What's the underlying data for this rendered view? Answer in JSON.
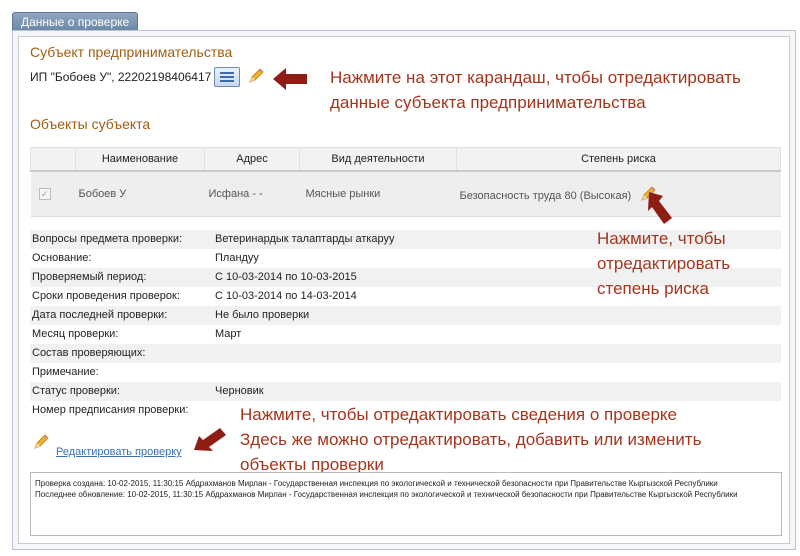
{
  "tab_title": "Данные о проверке",
  "subject": {
    "section_title": "Субъект предпринимательства",
    "text": "ИП \"Бобоев У\", 22202198406417"
  },
  "objects": {
    "section_title": "Объекты субъекта",
    "columns": [
      "Наименование",
      "Адрес",
      "Вид деятельности",
      "Степень риска"
    ],
    "rows": [
      {
        "checked": true,
        "name": "Бобоев У",
        "address": "Исфана - -",
        "activity": "Мясные рынки",
        "risk": "Безопасность труда 80 (Высокая)"
      }
    ]
  },
  "details": [
    {
      "label": "Вопросы предмета проверки:",
      "value": "Ветеринардык талаптарды аткаруу"
    },
    {
      "label": "Основание:",
      "value": "Пландуу"
    },
    {
      "label": "Проверяемый период:",
      "value": "С 10-03-2014 по 10-03-2015"
    },
    {
      "label": "Сроки проведения проверок:",
      "value": "С 10-03-2014 по 14-03-2014"
    },
    {
      "label": "Дата последней проверки:",
      "value": "Не было проверки"
    },
    {
      "label": "Месяц проверки:",
      "value": "Март"
    },
    {
      "label": "Состав проверяющих:",
      "value": ""
    },
    {
      "label": "Примечание:",
      "value": ""
    },
    {
      "label": "Статус проверки:",
      "value": "Черновик"
    },
    {
      "label": "Номер предписания проверки:",
      "value": ""
    }
  ],
  "edit_link": "Редактировать проверку",
  "log": {
    "created": "Проверка создана: 10-02-2015, 11:30:15 Абдрахманов Мирлан - Государственная инспекция по экологической и технической безопасности при Правительстве Кыргызской Республики",
    "updated": "Последнее обновление: 10-02-2015, 11:30:15 Абдрахманов Мирлан - Государственная инспекция по экологической и технической безопасности при Правительстве Кыргызской Республики"
  },
  "annotations": {
    "subject": [
      "Нажмите на этот карандаш, чтобы отредактировать",
      "данные субъекта предпринимательства"
    ],
    "risk": [
      "Нажмите, чтобы",
      "отредактировать",
      "степень риска"
    ],
    "inspection": [
      "Нажмите, чтобы отредактировать сведения о проверке",
      "Здесь же можно отредактировать, добавить или изменить",
      "объекты проверки"
    ]
  },
  "colors": {
    "annotation": "#a5341c",
    "arrow": "#8f1d14",
    "section": "#a25d12",
    "link": "#3b6fb6"
  },
  "icons": [
    "list-card-icon",
    "pencil-icon",
    "arrow-left-icon",
    "arrow-up-icon",
    "checkbox-icon"
  ]
}
